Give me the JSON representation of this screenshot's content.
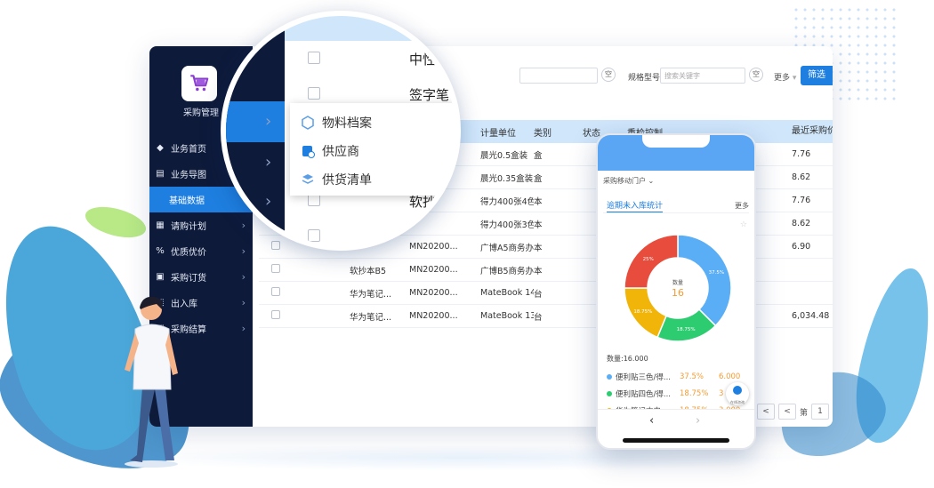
{
  "app": {
    "title": "采购管理",
    "brand_color": "#1e7fe0",
    "sidebar_bg": "#0e1a3a",
    "logo_icon": "cart-icon"
  },
  "sidebar": {
    "items": [
      {
        "label": "业务首页",
        "icon": "home-icon",
        "has_children": false
      },
      {
        "label": "业务导图",
        "icon": "map-icon",
        "has_children": false
      },
      {
        "label": "基础数据",
        "icon": "",
        "has_children": false,
        "active": true
      },
      {
        "label": "请购计划",
        "icon": "plan-icon",
        "has_children": true
      },
      {
        "label": "优质优价",
        "icon": "percent-icon",
        "has_children": true
      },
      {
        "label": "采购订货",
        "icon": "order-icon",
        "has_children": true
      },
      {
        "label": "出入库",
        "icon": "warehouse-icon",
        "has_children": true
      },
      {
        "label": "采购结算",
        "icon": "settle-icon",
        "has_children": true
      }
    ]
  },
  "filters": {
    "model_label": "规格型号",
    "model_placeholder": "搜索关键字",
    "clear_label": "空",
    "more_label": "更多",
    "filter_button": "筛选"
  },
  "table": {
    "columns": [
      "",
      "",
      "",
      "规格型号",
      "计量单位",
      "类别",
      "状态",
      "重检控制"
    ],
    "rows": [
      {
        "name": "",
        "code": "",
        "model": "晨光0.5盒装",
        "unit": "盒"
      },
      {
        "name": "",
        "code": "",
        "model": "晨光0.35盒装",
        "unit": "盒"
      },
      {
        "name": "",
        "code": "",
        "model": "得力400张4色...",
        "unit": "本"
      },
      {
        "name": "",
        "code": "",
        "model": "得力400张3色...",
        "unit": "本"
      },
      {
        "name": "",
        "code": "MN20200...",
        "model": "广博A5商务办公",
        "unit": "本"
      },
      {
        "name": "软抄本B5",
        "code": "MN20200...",
        "model": "广博B5商务办公",
        "unit": "本"
      },
      {
        "name": "华为笔记...",
        "code": "MN20200...",
        "model": "MateBook 14...",
        "unit": "台"
      },
      {
        "name": "华为笔记...",
        "code": "MN20200...",
        "model": "MateBook 13...",
        "unit": "台"
      }
    ],
    "right_header": "最近采购价",
    "right_values": [
      "7.76",
      "8.62",
      "7.76",
      "8.62",
      "6.90",
      "",
      "",
      "6,034.48"
    ]
  },
  "pager": {
    "prev": "<",
    "page_label": "第",
    "page": "1"
  },
  "lens": {
    "cell_texts": [
      "中性",
      "签字笔",
      "软抄本"
    ],
    "popup_items": [
      {
        "label": "物料档案",
        "icon": "cube-icon"
      },
      {
        "label": "供应商",
        "icon": "supplier-icon"
      },
      {
        "label": "供货清单",
        "icon": "list-icon"
      }
    ]
  },
  "mobile": {
    "portal": "采购移动门户",
    "section_title": "逾期未入库统计",
    "more": "更多",
    "center_label": "数量",
    "center_value": "16",
    "total_label": "数量:16.000",
    "bubble_text": "在线咨询",
    "chart_data": {
      "type": "pie",
      "values": [
        37.5,
        18.75,
        18.75,
        25
      ],
      "labels": [
        "37.5%",
        "18.75%",
        "18.75%",
        "25%"
      ],
      "colors": [
        "#5aaef5",
        "#2ecc71",
        "#f1b50a",
        "#e74c3c"
      ]
    },
    "legend": [
      {
        "name": "便利贴三色/得...",
        "percent": "37.5%",
        "value": "6.000",
        "color": "#5aaef5"
      },
      {
        "name": "便利贴四色/得...",
        "percent": "18.75%",
        "value": "3",
        "color": "#2ecc71"
      },
      {
        "name": "华为笔记本电...",
        "percent": "18.75%",
        "value": "3.000",
        "color": "#f1b50a"
      }
    ],
    "nav_back": "‹",
    "nav_forward": "›"
  }
}
